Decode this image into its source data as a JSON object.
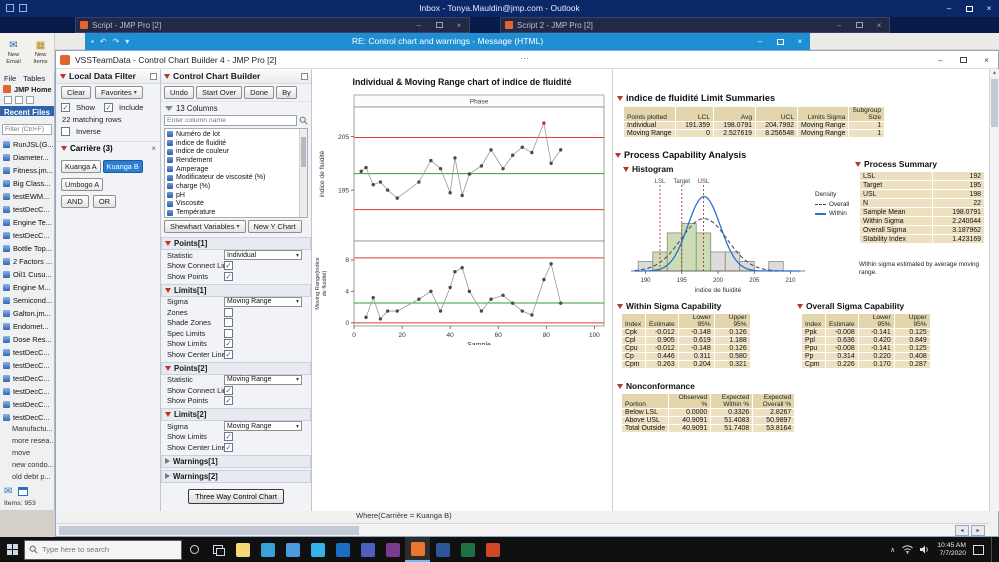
{
  "windows": {
    "outlook_title": "Inbox - Tonya.Mauldin@jmp.com - Outlook",
    "script1_title": "Script - JMP Pro [2]",
    "script2_title": "Script 2 - JMP Pro [2]",
    "message_title": "RE: Control chart and warnings - Message (HTML)",
    "jmp_title": "VSSTeamData - Control Chart Builder 4 - JMP Pro [2]"
  },
  "outlook_ribbon": {
    "new_email": "New Email",
    "new_items": "New Items"
  },
  "home": {
    "menu": [
      "File",
      "Tables"
    ],
    "title": "JMP Home",
    "recent_files_header": "Recent Files",
    "filter_placeholder": "Filter (Ctrl+F)",
    "files": [
      "RunJSL(G...",
      "Diameter...",
      "Fitness.jm...",
      "Big Class...",
      "testEWM...",
      "testDecC...",
      "Engine Te...",
      "testDecC...",
      "Bottle Top...",
      "2 Factors ...",
      "Oil1 Cusu...",
      "Engine M...",
      "Semicond...",
      "Galton.jm...",
      "Endomet...",
      "Dose Res...",
      "testDecC...",
      "testDecC...",
      "testDecC...",
      "testDecC...",
      "testDecC...",
      "testDecC..."
    ],
    "folders": [
      "Manufactu...",
      "more resea...",
      "move",
      "new condo...",
      "old debt p..."
    ],
    "items_count": "Items: 953"
  },
  "local_data_filter": {
    "title": "Local Data Filter",
    "clear": "Clear",
    "favorites": "Favorites",
    "show": "Show",
    "show_checked": true,
    "include": "Include",
    "include_checked": true,
    "matching": "22 matching rows",
    "inverse": "Inverse",
    "inverse_checked": false,
    "group": {
      "title": "Carrière (3)",
      "values": [
        {
          "label": "Kuanga A",
          "selected": false
        },
        {
          "label": "Kuanga B",
          "selected": true
        },
        {
          "label": "Umbogo A",
          "selected": false
        }
      ]
    },
    "and": "AND",
    "or": "OR"
  },
  "builder": {
    "title": "Control Chart Builder",
    "buttons": [
      "Undo",
      "Start Over",
      "Done",
      "By"
    ],
    "columns_header": "13 Columns",
    "search_placeholder": "Enter column name",
    "columns": [
      "Numéro de lot",
      "indice de fluidité",
      "indice de couleur",
      "Rendement",
      "Amperage",
      "Modificateur de viscosité (%)",
      "charge (%)",
      "pH",
      "Viscosité",
      "Température"
    ],
    "chart_type_button": "Shewhart Variables",
    "new_y_button": "New Y Chart",
    "sections": [
      {
        "title": "Points[1]",
        "rows": [
          {
            "type": "dropdown",
            "label": "Statistic",
            "value": "Individual"
          },
          {
            "type": "check",
            "label": "Show Connect Line",
            "checked": true
          },
          {
            "type": "check",
            "label": "Show Points",
            "checked": true
          }
        ]
      },
      {
        "title": "Limits[1]",
        "rows": [
          {
            "type": "dropdown",
            "label": "Sigma",
            "value": "Moving Range"
          },
          {
            "type": "check",
            "label": "Zones",
            "checked": false
          },
          {
            "type": "check",
            "label": "Shade Zones",
            "checked": false
          },
          {
            "type": "check",
            "label": "Spec Limits",
            "checked": false
          },
          {
            "type": "check",
            "label": "Show Limits",
            "checked": true
          },
          {
            "type": "check",
            "label": "Show Center Line",
            "checked": true
          }
        ]
      },
      {
        "title": "Points[2]",
        "rows": [
          {
            "type": "dropdown",
            "label": "Statistic",
            "value": "Moving Range"
          },
          {
            "type": "check",
            "label": "Show Connect Line",
            "checked": true
          },
          {
            "type": "check",
            "label": "Show Points",
            "checked": true
          }
        ]
      },
      {
        "title": "Limits[2]",
        "rows": [
          {
            "type": "dropdown",
            "label": "Sigma",
            "value": "Moving Range"
          },
          {
            "type": "check",
            "label": "Show Limits",
            "checked": true
          },
          {
            "type": "check",
            "label": "Show Center Line",
            "checked": true
          }
        ]
      },
      {
        "title": "Warnings[1]",
        "collapsed": true
      },
      {
        "title": "Warnings[2]",
        "collapsed": true
      }
    ],
    "three_way_button": "Three Way Control Chart"
  },
  "chart_data": [
    {
      "type": "line",
      "name": "individual-chart",
      "title": "Individual & Moving Range chart of indice de fluidité",
      "phase_label": "Phase",
      "ylabel": "indice de fluidité",
      "xlabel": "Sample",
      "x": [
        3,
        5,
        8,
        11,
        14,
        18,
        27,
        32,
        36,
        40,
        42,
        45,
        48,
        53,
        57,
        62,
        66,
        70,
        74,
        79,
        82,
        86
      ],
      "y": [
        198.5,
        199.2,
        196.0,
        196.5,
        195.0,
        193.5,
        196.5,
        200.5,
        199.0,
        194.5,
        201.0,
        194.0,
        198.0,
        199.5,
        202.5,
        199.0,
        201.5,
        203.0,
        202.0,
        207.5,
        200.0,
        202.5
      ],
      "avg": 198.0791,
      "ucl": 204.7992,
      "lcl": 191.359,
      "ylim": [
        185.5,
        210.5
      ],
      "yticks": [
        195,
        205
      ],
      "xlim": [
        0,
        104
      ],
      "xticks": [
        0,
        20,
        40,
        60,
        80,
        100
      ],
      "out_index": 19
    },
    {
      "type": "line",
      "name": "moving-range-chart",
      "ylabel": "Moving Range(indice de fluidité)",
      "x": [
        5,
        8,
        11,
        14,
        18,
        27,
        32,
        36,
        40,
        42,
        45,
        48,
        53,
        57,
        62,
        66,
        70,
        74,
        79,
        82,
        86
      ],
      "y": [
        0.7,
        3.2,
        0.5,
        1.5,
        1.5,
        3.0,
        4.0,
        1.5,
        4.5,
        6.5,
        7.0,
        4.0,
        1.5,
        3.0,
        3.5,
        2.5,
        1.5,
        1.0,
        5.5,
        7.5,
        2.5
      ],
      "avg": 2.527619,
      "ucl": 8.256548,
      "lcl": 0,
      "ylim": [
        -0.4,
        10.4
      ],
      "yticks": [
        0,
        4,
        8
      ]
    },
    {
      "type": "histogram",
      "name": "capability-histogram",
      "bin_start": 189,
      "bin_width": 2,
      "counts": [
        1,
        2,
        4,
        5,
        4,
        2,
        2,
        1,
        0,
        1
      ],
      "lsl": 192,
      "target": 195,
      "usl": 198,
      "mean": 198.0791,
      "within_sigma": 2.240044,
      "overall_sigma": 3.187962,
      "xticks": [
        190,
        195,
        200,
        205,
        210
      ],
      "xlabel": "indice de fluidité",
      "spec_labels": [
        "LSL",
        "Target",
        "USL"
      ],
      "legend": {
        "title": "Density",
        "entries": [
          "Overall",
          "Within"
        ]
      }
    }
  ],
  "limit_summaries": {
    "title": "indice de fluidité Limit Summaries",
    "col_headers": [
      "Points plotted",
      "LCL",
      "Avg",
      "UCL",
      "Limits Sigma",
      "Subgroup Size"
    ],
    "rows": [
      [
        "Individual",
        "191.359",
        "198.0791",
        "204.7992",
        "Moving Range",
        "1"
      ],
      [
        "Moving Range",
        "0",
        "2.527619",
        "8.256548",
        "Moving Range",
        "1"
      ]
    ]
  },
  "capability": {
    "title": "Process Capability Analysis",
    "histogram_title": "Histogram",
    "process_summary": {
      "title": "Process Summary",
      "rows": [
        [
          "LSL",
          "192"
        ],
        [
          "Target",
          "195"
        ],
        [
          "USL",
          "198"
        ],
        [
          "N",
          "22"
        ],
        [
          "Sample Mean",
          "198.0791"
        ],
        [
          "Within Sigma",
          "2.240044"
        ],
        [
          "Overall Sigma",
          "3.187962"
        ],
        [
          "Stability Index",
          "1.423169"
        ]
      ]
    },
    "note": "Within sigma estimated by average moving range.",
    "within": {
      "title": "Within Sigma Capability",
      "col_headers": [
        "Index",
        "Estimate",
        "Lower 95%",
        "Upper 95%"
      ],
      "rows": [
        [
          "Cpk",
          "-0.012",
          "-0.148",
          "0.126"
        ],
        [
          "Cpl",
          "0.905",
          "0.619",
          "1.188"
        ],
        [
          "Cpu",
          "-0.012",
          "-0.148",
          "0.126"
        ],
        [
          "Cp",
          "0.446",
          "0.311",
          "0.580"
        ],
        [
          "Cpm",
          "0.263",
          "0.204",
          "0.321"
        ]
      ]
    },
    "overall": {
      "title": "Overall Sigma Capability",
      "col_headers": [
        "Index",
        "Estimate",
        "Lower 95%",
        "Upper 95%"
      ],
      "rows": [
        [
          "Ppk",
          "-0.008",
          "-0.141",
          "0.125"
        ],
        [
          "Ppl",
          "0.636",
          "0.420",
          "0.849"
        ],
        [
          "Ppu",
          "-0.008",
          "-0.141",
          "0.125"
        ],
        [
          "Pp",
          "0.314",
          "0.220",
          "0.408"
        ],
        [
          "Cpm",
          "0.226",
          "0.170",
          "0.287"
        ]
      ]
    },
    "nonconformance": {
      "title": "Nonconformance",
      "col_headers": [
        "Portion",
        "Observed %",
        "Expected Within %",
        "Expected Overall %"
      ],
      "rows": [
        [
          "Below LSL",
          "0.0000",
          "0.3326",
          "2.8267"
        ],
        [
          "Above USL",
          "40.9091",
          "51.4083",
          "50.9897"
        ],
        [
          "Total Outside",
          "40.9091",
          "51.7408",
          "53.8164"
        ]
      ]
    }
  },
  "status_where": "Where(Carrière = Kuanga B)",
  "taskbar": {
    "search_placeholder": "Type here to search",
    "time": "10:45 AM",
    "date": "7/7/2020",
    "apps": [
      {
        "name": "file-explorer",
        "color": "#f8d775"
      },
      {
        "name": "edge",
        "color": "#3aa0da"
      },
      {
        "name": "chrome",
        "color": "#4a9be0"
      },
      {
        "name": "internet-explorer",
        "color": "#35b3e8"
      },
      {
        "name": "outlook",
        "color": "#1a6fc4"
      },
      {
        "name": "teams",
        "color": "#4e5fbf"
      },
      {
        "name": "onenote",
        "color": "#7a3b8f"
      },
      {
        "name": "jmp",
        "color": "#e8762c",
        "active": true
      },
      {
        "name": "word",
        "color": "#2b579a"
      },
      {
        "name": "excel",
        "color": "#1e7145"
      },
      {
        "name": "powerpoint",
        "color": "#d04727"
      }
    ]
  }
}
